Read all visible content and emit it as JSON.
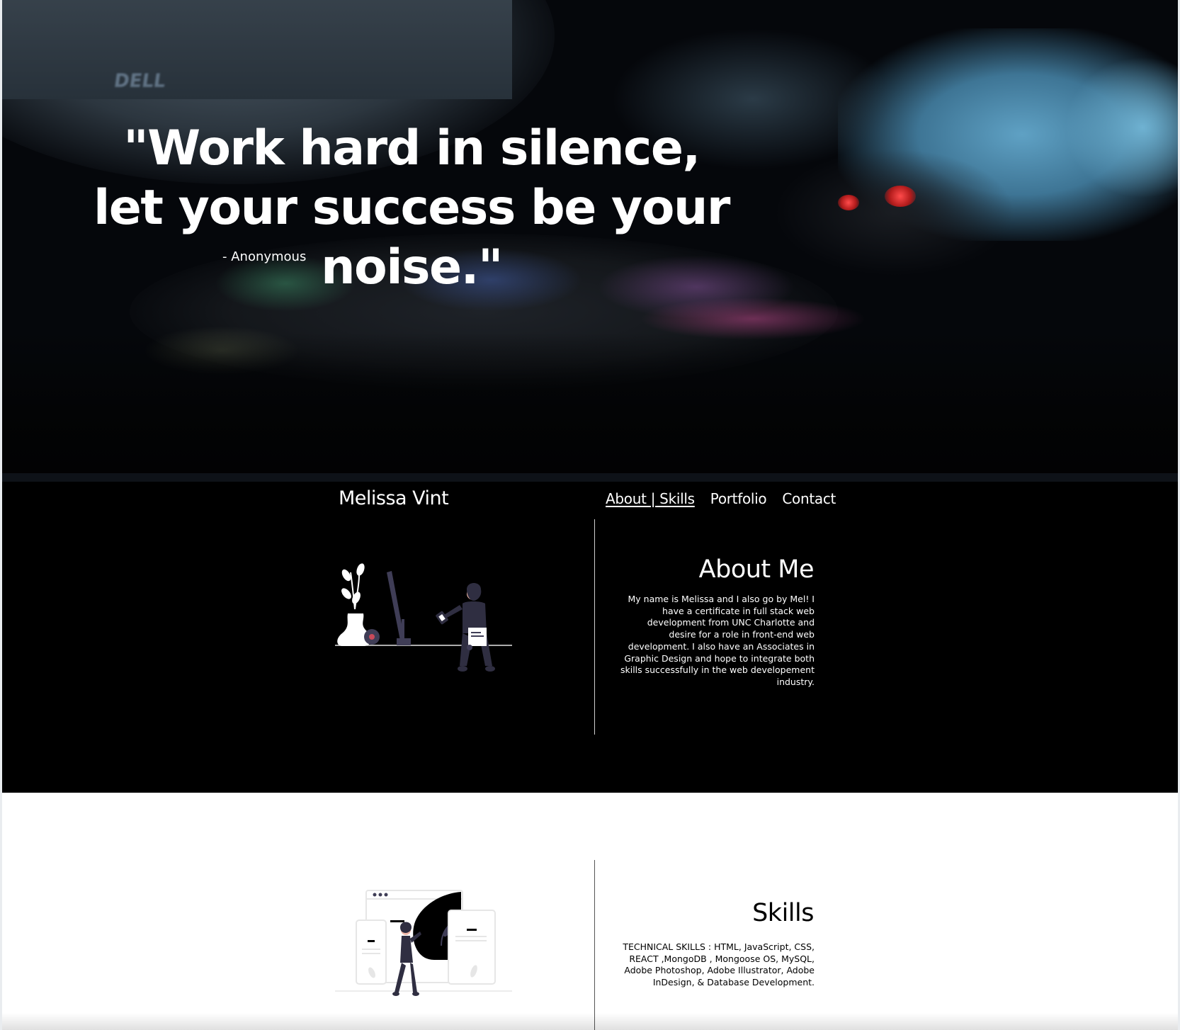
{
  "hero": {
    "quote": "\"Work hard in silence, let your success be your noise.\"",
    "author": "- Anonymous",
    "monitor_logo": "DELL"
  },
  "header": {
    "brand": "Melissa Vint",
    "nav": [
      {
        "label": "About | Skills",
        "active": true
      },
      {
        "label": "Portfolio",
        "active": false
      },
      {
        "label": "Contact",
        "active": false
      }
    ]
  },
  "about": {
    "title": "About Me",
    "text": "My name is Melissa and I also go by Mel! I have a certificate in full stack web development from UNC Charlotte and desire for a role in front-end web development. I also have an Associates in Graphic Design and hope to integrate both skills successfully in the web developement industry."
  },
  "skills": {
    "title": "Skills",
    "text": "TECHNICAL SKILLS : HTML, JavaScript, CSS, REACT ,MongoDB , Mongoose OS, MySQL, Adobe Photoshop, Adobe Illustrator, Adobe InDesign, & Database Development."
  },
  "colors": {
    "hero_bg": "#05070b",
    "about_bg": "#000000",
    "skills_bg": "#ffffff",
    "text_light": "#ffffff",
    "text_dark": "#000000"
  }
}
